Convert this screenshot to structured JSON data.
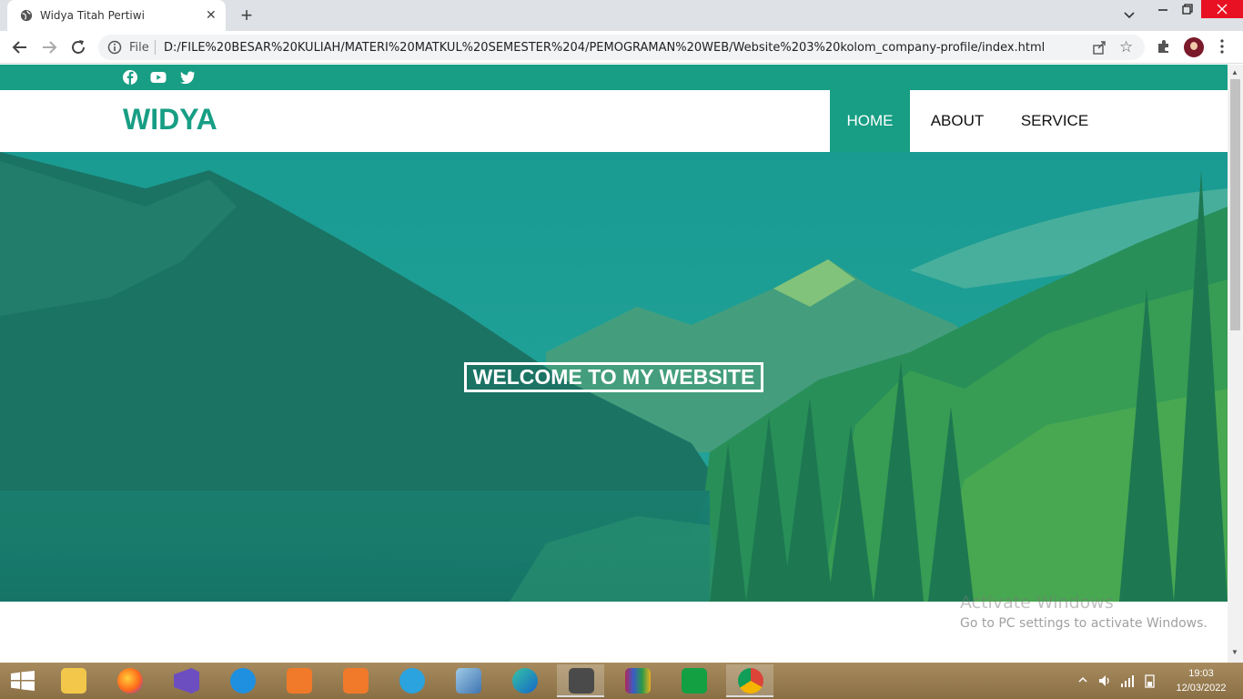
{
  "browser": {
    "tab_title": "Widya Titah Pertiwi",
    "tab_close": "✕",
    "new_tab": "+",
    "omnibox_scheme": "File",
    "url": "D:/FILE%20BESAR%20KULIAH/MATERI%20MATKUL%20SEMESTER%204/PEMOGRAMAN%20WEB/Website%203%20kolom_company-profile/index.html"
  },
  "page": {
    "brand": "WIDYA",
    "nav": [
      {
        "label": "HOME"
      },
      {
        "label": "ABOUT"
      },
      {
        "label": "SERVICE"
      }
    ],
    "social_icons": [
      "facebook-icon",
      "youtube-icon",
      "twitter-icon"
    ],
    "hero_title": "WELCOME TO MY WEBSITE",
    "accent_color": "#179e84"
  },
  "watermark": {
    "title": "Activate Windows",
    "subtitle": "Go to PC settings to activate Windows."
  },
  "taskbar": {
    "apps": [
      "file-explorer",
      "firefox",
      "visual-studio",
      "internet-explorer",
      "screen-recorder",
      "camera",
      "telegram",
      "virtualbox",
      "edge",
      "sublime-text",
      "winrar",
      "store",
      "chrome"
    ],
    "time": "19:03",
    "date": "12/03/2022"
  }
}
